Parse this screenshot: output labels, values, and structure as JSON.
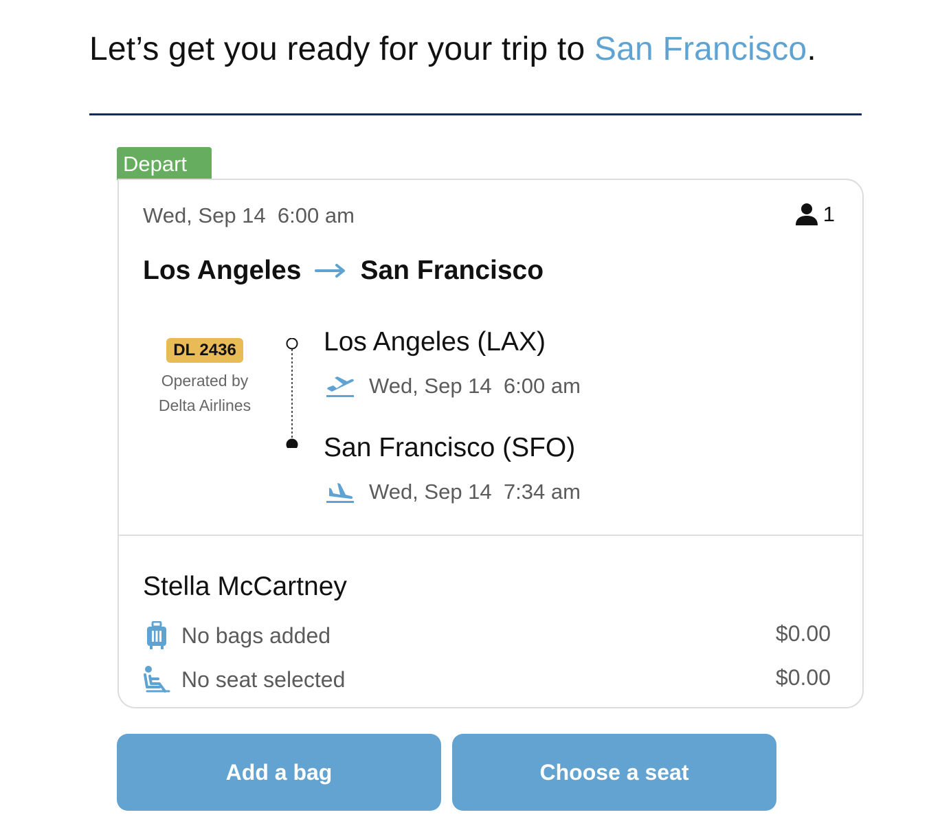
{
  "header": {
    "title_prefix": "Let’s get you ready for your trip to ",
    "title_destination": "San Francisco",
    "title_suffix": "."
  },
  "trip": {
    "tab_label": "Depart",
    "date_time": "Wed, Sep 14  6:00 am",
    "passenger_count": "1",
    "route_from": "Los Angeles",
    "route_to": "San Francisco",
    "flight_number": "DL 2436",
    "operated_line1": "Operated by",
    "operated_line2": "Delta Airlines",
    "origin": {
      "name": "Los Angeles (LAX)",
      "time": "Wed, Sep 14  6:00 am"
    },
    "destination": {
      "name": "San Francisco (SFO)",
      "time": "Wed, Sep 14  7:34 am"
    }
  },
  "passenger": {
    "name": "Stella McCartney",
    "bags_label": "No bags added",
    "bags_price": "$0.00",
    "seat_label": "No seat selected",
    "seat_price": "$0.00"
  },
  "actions": {
    "add_bag": "Add a bag",
    "choose_seat": "Choose a seat"
  },
  "colors": {
    "accent": "#5fa3d2",
    "button": "#62a3d1",
    "divider": "#0d2c5e",
    "depart_tab": "#66ad5f",
    "flight_badge": "#e8bb56"
  },
  "icons": [
    "person-icon",
    "arrow-right-icon",
    "takeoff-icon",
    "landing-icon",
    "luggage-icon",
    "seat-icon"
  ]
}
